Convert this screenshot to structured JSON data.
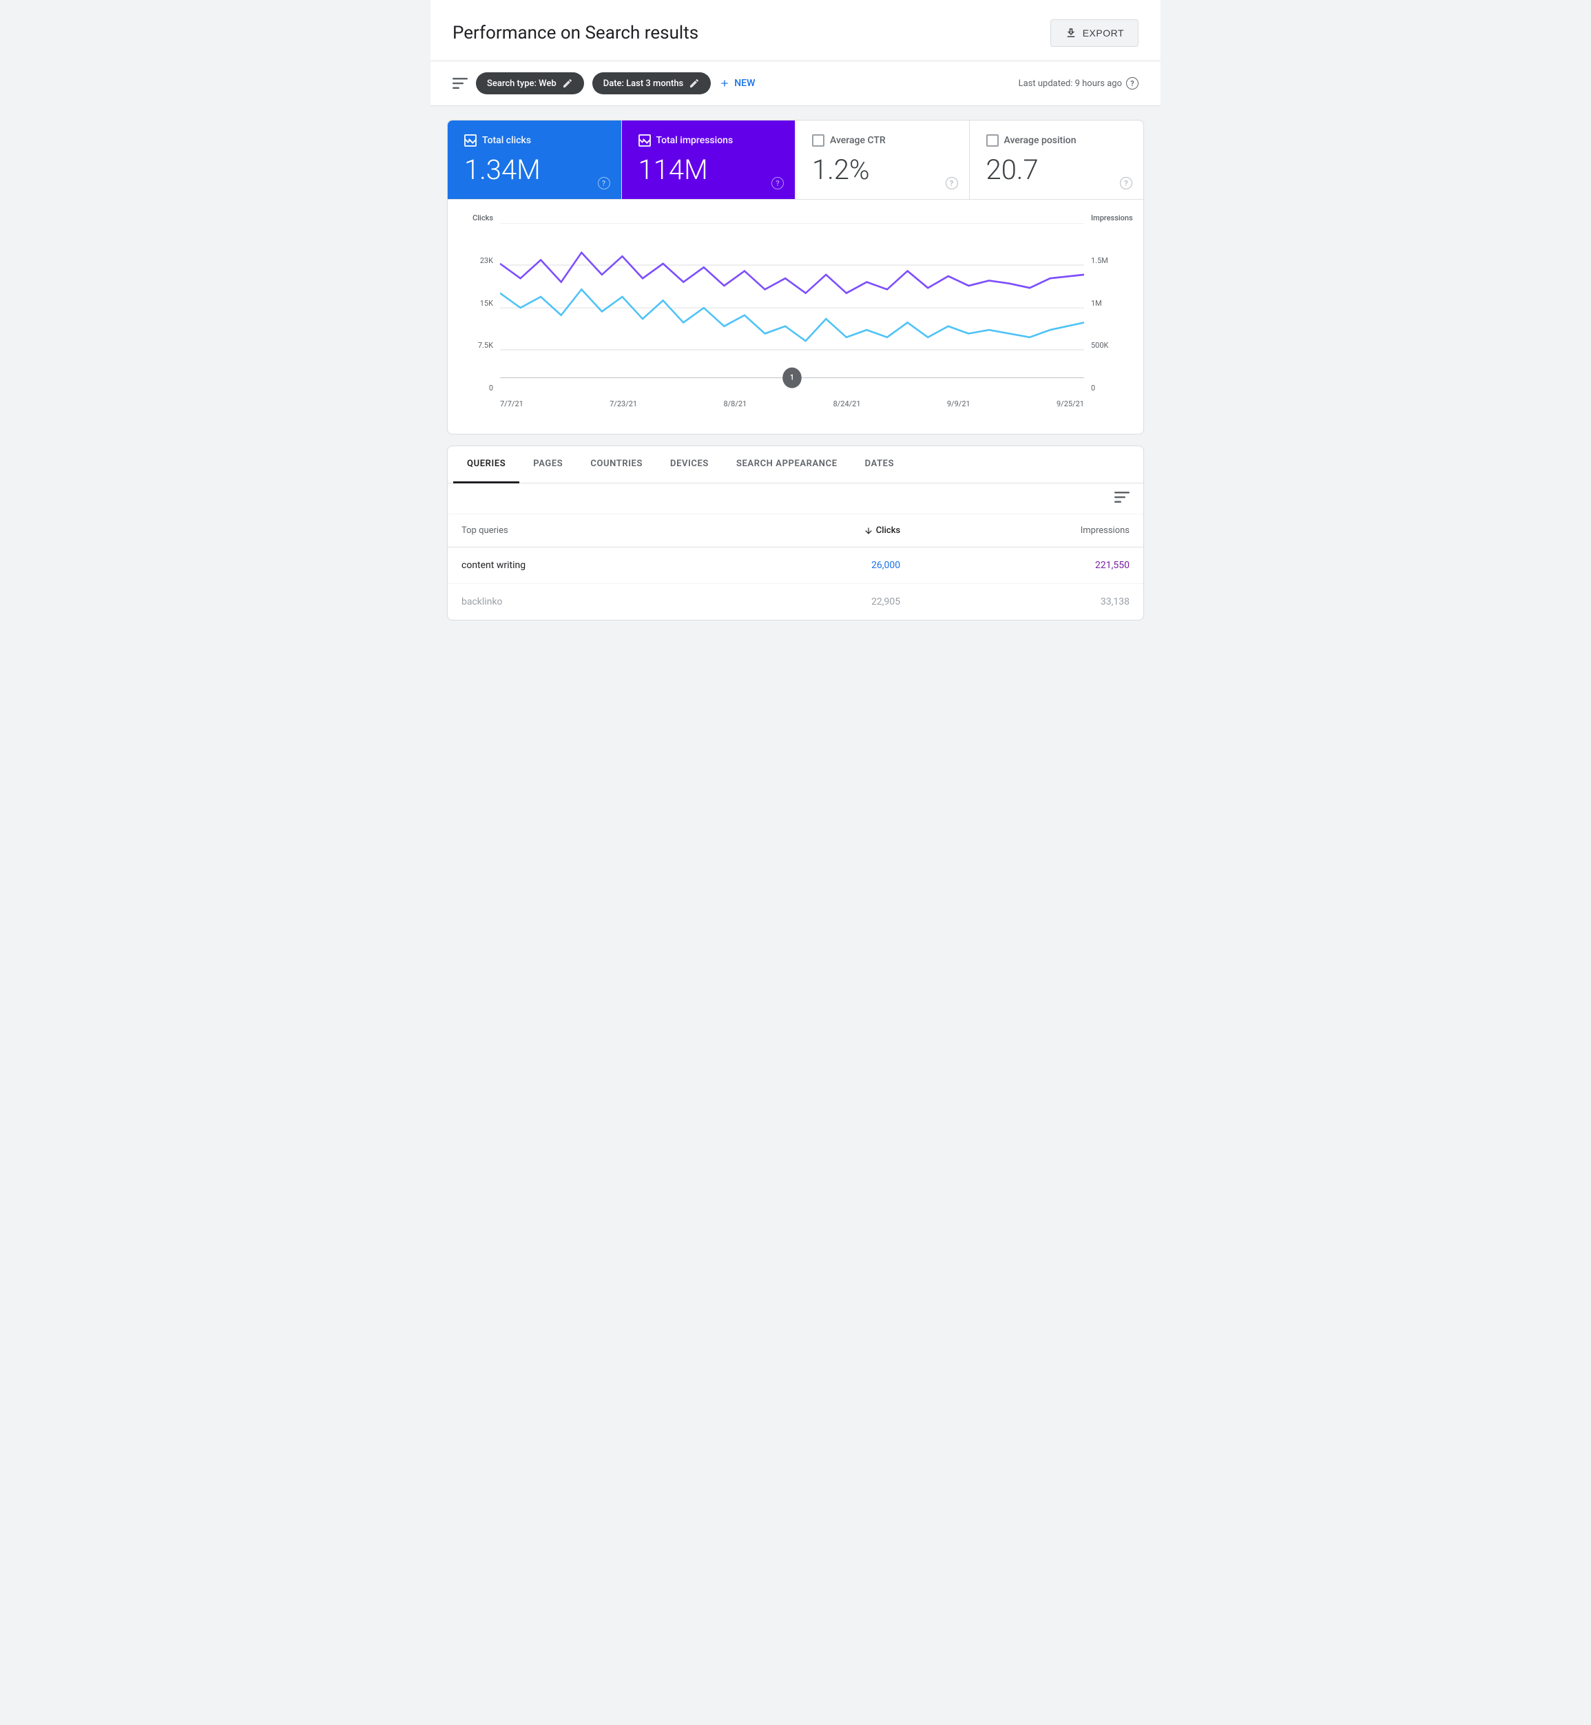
{
  "header": {
    "title": "Performance on Search results",
    "export_label": "EXPORT"
  },
  "filter_bar": {
    "search_type_chip": "Search type: Web",
    "date_chip": "Date: Last 3 months",
    "new_filter_label": "NEW",
    "last_updated": "Last updated: 9 hours ago"
  },
  "metrics": [
    {
      "id": "total-clicks",
      "label": "Total clicks",
      "value": "1.34M",
      "active": true,
      "variant": "blue",
      "checked": true
    },
    {
      "id": "total-impressions",
      "label": "Total impressions",
      "value": "114M",
      "active": true,
      "variant": "purple",
      "checked": true
    },
    {
      "id": "average-ctr",
      "label": "Average CTR",
      "value": "1.2%",
      "active": false,
      "variant": "none",
      "checked": false
    },
    {
      "id": "average-position",
      "label": "Average position",
      "value": "20.7",
      "active": false,
      "variant": "none",
      "checked": false
    }
  ],
  "chart": {
    "y_left_label": "Clicks",
    "y_right_label": "Impressions",
    "y_left_values": [
      "23K",
      "15K",
      "7.5K",
      "0"
    ],
    "y_right_values": [
      "1.5M",
      "1M",
      "500K",
      "0"
    ],
    "x_labels": [
      "7/7/21",
      "7/23/21",
      "8/8/21",
      "8/24/21",
      "9/9/21",
      "9/25/21"
    ],
    "annotation": {
      "label": "1",
      "x_label": "8/24/21"
    }
  },
  "tabs": [
    {
      "id": "queries",
      "label": "QUERIES",
      "active": true
    },
    {
      "id": "pages",
      "label": "PAGES",
      "active": false
    },
    {
      "id": "countries",
      "label": "COUNTRIES",
      "active": false
    },
    {
      "id": "devices",
      "label": "DEVICES",
      "active": false
    },
    {
      "id": "search-appearance",
      "label": "SEARCH APPEARANCE",
      "active": false
    },
    {
      "id": "dates",
      "label": "DATES",
      "active": false
    }
  ],
  "table": {
    "col_query": "Top queries",
    "col_clicks": "Clicks",
    "col_impressions": "Impressions",
    "rows": [
      {
        "query": "content writing",
        "clicks": "26,000",
        "impressions": "221,550",
        "secondary": false
      },
      {
        "query": "backlinko",
        "clicks": "22,905",
        "impressions": "33,138",
        "secondary": true
      }
    ]
  }
}
